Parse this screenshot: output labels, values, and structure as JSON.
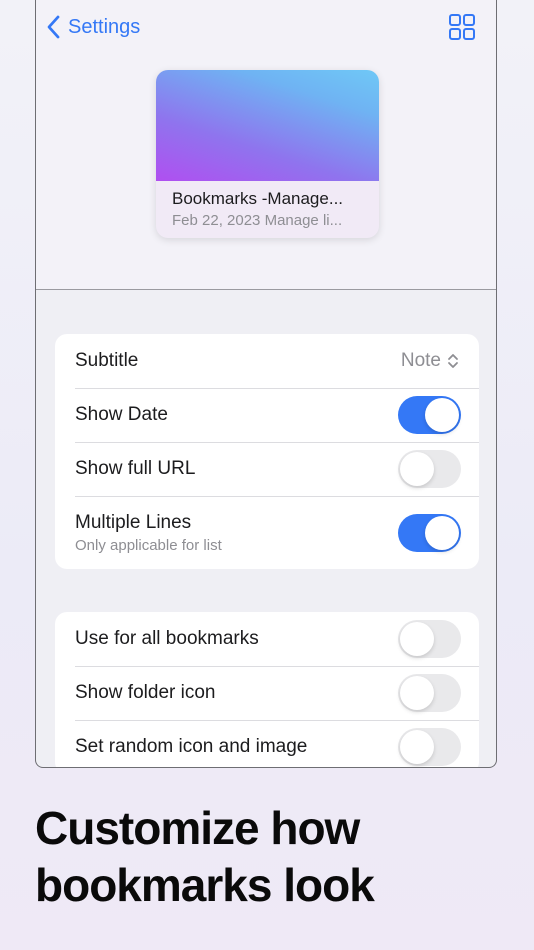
{
  "nav": {
    "back_label": "Settings",
    "back_icon": "chevron-left-icon",
    "grid_icon": "grid-icon",
    "accent": "#3478f6"
  },
  "preview_card": {
    "title": "Bookmarks -Manage...",
    "subtitle": "Feb 22, 2023 Manage li..."
  },
  "settings_group_1": [
    {
      "label": "Subtitle",
      "value": "Note",
      "type": "select"
    },
    {
      "label": "Show Date",
      "type": "toggle",
      "on": true
    },
    {
      "label": "Show full URL",
      "type": "toggle",
      "on": false
    },
    {
      "label": "Multiple Lines",
      "caption": "Only applicable for list",
      "type": "toggle",
      "on": true
    }
  ],
  "settings_group_2": [
    {
      "label": "Use for all bookmarks",
      "type": "toggle",
      "on": false
    },
    {
      "label": "Show folder icon",
      "type": "toggle",
      "on": false
    },
    {
      "label": "Set random icon and image",
      "type": "toggle",
      "on": false
    }
  ],
  "headline": {
    "line1": "Customize how",
    "line2": "bookmarks look"
  }
}
